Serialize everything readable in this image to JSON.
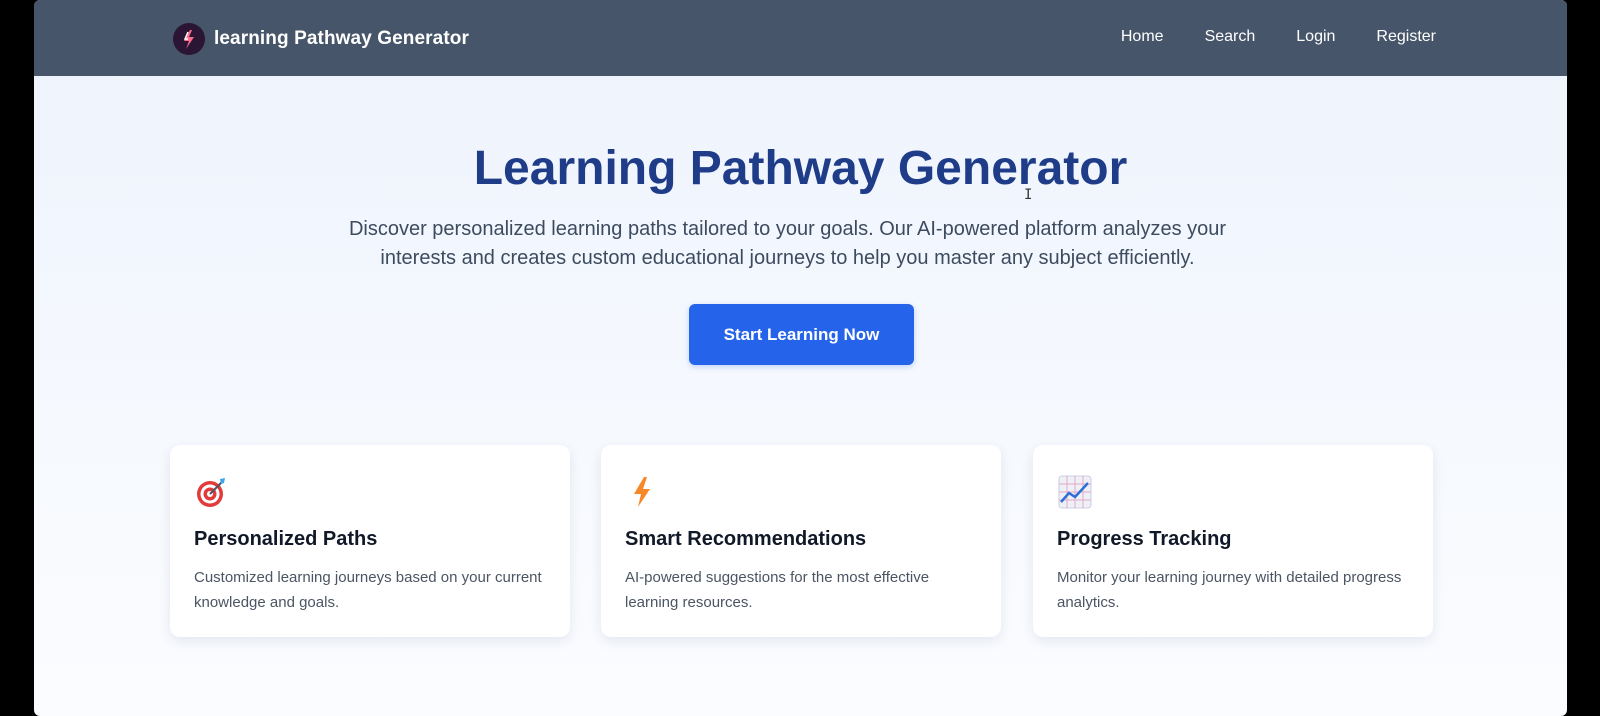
{
  "navbar": {
    "brand": "learning Pathway Generator",
    "links": [
      "Home",
      "Search",
      "Login",
      "Register"
    ]
  },
  "hero": {
    "title": "Learning Pathway Generator",
    "description": "Discover personalized learning paths tailored to your goals. Our AI-powered platform analyzes your interests and creates custom educational journeys to help you master any subject efficiently.",
    "cta_label": "Start Learning Now"
  },
  "features": [
    {
      "icon": "target-icon",
      "title": "Personalized Paths",
      "text": "Customized learning journeys based on your current knowledge and goals."
    },
    {
      "icon": "lightning-icon",
      "title": "Smart Recommendations",
      "text": "AI-powered suggestions for the most effective learning resources."
    },
    {
      "icon": "chart-increasing-icon",
      "title": "Progress Tracking",
      "text": "Monitor your learning journey with detailed progress analytics."
    }
  ],
  "colors": {
    "navbar": "#465569",
    "title": "#1f3c88",
    "accent": "#2563eb"
  }
}
